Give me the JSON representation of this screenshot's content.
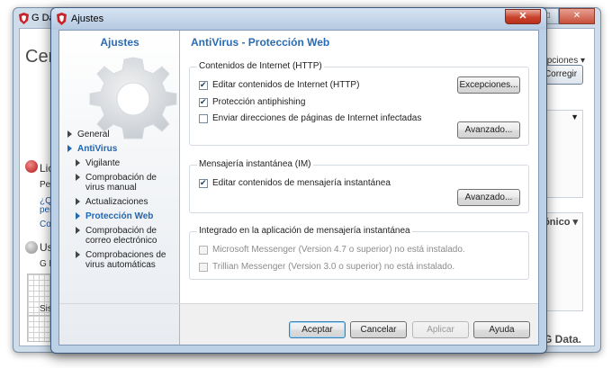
{
  "background_window": {
    "title": "G Data",
    "left_title": "Cen",
    "license_label": "Lic",
    "line1": "Per",
    "link1": "¿Qu",
    "link2": "per",
    "link3": "Com",
    "usage_label": "Us",
    "g_line": "G D",
    "sist_line": "Sist",
    "right_top": "opciones ▾",
    "corregir": "Corregir",
    "onico": "ónico ▾",
    "brand": "r. G Data."
  },
  "dialog": {
    "title": "Ajustes",
    "close_glyph": "✕",
    "nav": {
      "heading": "Ajustes",
      "items": [
        {
          "label": "General",
          "level": 0,
          "active": false
        },
        {
          "label": "AntiVirus",
          "level": 0,
          "active": true
        },
        {
          "label": "Vigilante",
          "level": 1,
          "active": false
        },
        {
          "label": "Comprobación de virus manual",
          "level": 1,
          "active": false
        },
        {
          "label": "Actualizaciones",
          "level": 1,
          "active": false
        },
        {
          "label": "Protección Web",
          "level": 1,
          "active": true
        },
        {
          "label": "Comprobación de correo electrónico",
          "level": 1,
          "active": false
        },
        {
          "label": "Comprobaciones de virus automáticas",
          "level": 1,
          "active": false
        }
      ]
    },
    "content": {
      "title": "AntiVirus - Protección Web",
      "group_http": {
        "label": "Contenidos de Internet (HTTP)",
        "chk_edit": {
          "label": "Editar contenidos de Internet (HTTP)",
          "checked": true
        },
        "chk_phish": {
          "label": "Protección antiphishing",
          "checked": true
        },
        "chk_send": {
          "label": "Enviar direcciones de páginas de Internet infectadas",
          "checked": false
        },
        "btn_exceptions": "Excepciones...",
        "btn_advanced": "Avanzado..."
      },
      "group_im": {
        "label": "Mensajería instantánea (IM)",
        "chk_edit": {
          "label": "Editar contenidos de mensajería instantánea",
          "checked": true
        },
        "btn_advanced": "Avanzado..."
      },
      "group_integrated": {
        "label": "Integrado en la aplicación de mensajería instantánea",
        "chk_msn": {
          "label": "Microsoft Messenger (Version 4.7 o superior) no está instalado.",
          "checked": false,
          "enabled": false
        },
        "chk_trillian": {
          "label": "Trillian Messenger (Version 3.0 o superior) no está instalado.",
          "checked": false,
          "enabled": false
        }
      }
    },
    "footer": {
      "accept": "Aceptar",
      "cancel": "Cancelar",
      "apply": "Aplicar",
      "help": "Ayuda"
    }
  },
  "colors": {
    "accent_blue": "#2b6bb1",
    "close_red": "#c8432c"
  }
}
